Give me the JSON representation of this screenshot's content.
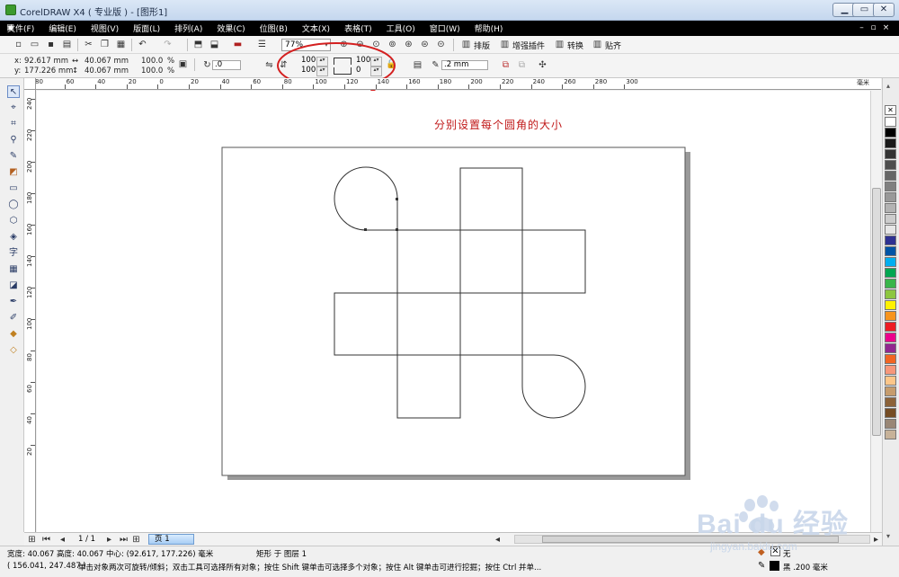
{
  "window": {
    "title": "CorelDRAW X4 ( 专业版 ) - [图形1]",
    "min_label": "▁",
    "max_label": "▭",
    "close_label": "✕"
  },
  "menu": {
    "items": [
      "文件(F)",
      "编辑(E)",
      "视图(V)",
      "版面(L)",
      "排列(A)",
      "效果(C)",
      "位图(B)",
      "文本(X)",
      "表格(T)",
      "工具(O)",
      "窗口(W)",
      "帮助(H)"
    ]
  },
  "toolbar": {
    "zoom": "77%",
    "typeset_label": "排版",
    "plugin_label": "增强插件",
    "convert_label": "转换",
    "paste_label": "贴齐"
  },
  "property_bar": {
    "x_label": "x:",
    "x_value": "92.617 mm",
    "y_label": "y:",
    "y_value": "177.226 mm",
    "w_value": "40.067 mm",
    "h_value": "40.067 mm",
    "scale_x": "100.0",
    "scale_y": "100.0",
    "pct": "%",
    "rotation": ".0",
    "corner_tl": "100",
    "corner_bl": "100",
    "corner_tr": "100",
    "corner_br": "0",
    "outline_width": ".2 mm"
  },
  "rulers": {
    "top": [
      "80",
      "60",
      "40",
      "20",
      "0",
      "20",
      "40",
      "60",
      "80",
      "100",
      "120",
      "140",
      "160",
      "180",
      "200",
      "220",
      "240",
      "260",
      "280",
      "300"
    ],
    "top_unit": "毫米",
    "left": [
      "240",
      "220",
      "200",
      "180",
      "160",
      "140",
      "120",
      "100",
      "80",
      "60",
      "40",
      "20"
    ]
  },
  "annotation": "分别设置每个圆角的大小",
  "page_nav": {
    "current": "1 / 1",
    "tab": "页 1"
  },
  "status": {
    "dimensions": "宽度: 40.067 高度: 40.067 中心: (92.617, 177.226) 毫米",
    "object": "矩形 于 图层 1",
    "fill_label": "无",
    "coords": "( 156.041, 247.487 )",
    "hint": "单击对象两次可旋转/倾斜；双击工具可选择所有对象；按住 Shift 键单击可选择多个对象；按住 Alt 键单击可进行挖掘；按住 Ctrl 并单...",
    "outline_label": "黑 .200 毫米"
  },
  "watermark": {
    "brand": "Bai du 经验",
    "url": "jingyan.baidu.com"
  },
  "palette_colors": [
    "#ffffff",
    "#000000",
    "#1a1a1a",
    "#333333",
    "#4d4d4d",
    "#666666",
    "#808080",
    "#999999",
    "#b3b3b3",
    "#cccccc",
    "#e6e6e6",
    "#2e3192",
    "#0054a6",
    "#00aeef",
    "#00a651",
    "#39b54a",
    "#8dc63f",
    "#fff200",
    "#f7941d",
    "#ed1c24",
    "#ec008c",
    "#92278f",
    "#f26522",
    "#f7977a",
    "#fdc689",
    "#c69c6d",
    "#8c6239",
    "#754c24",
    "#998675",
    "#c7b299"
  ]
}
